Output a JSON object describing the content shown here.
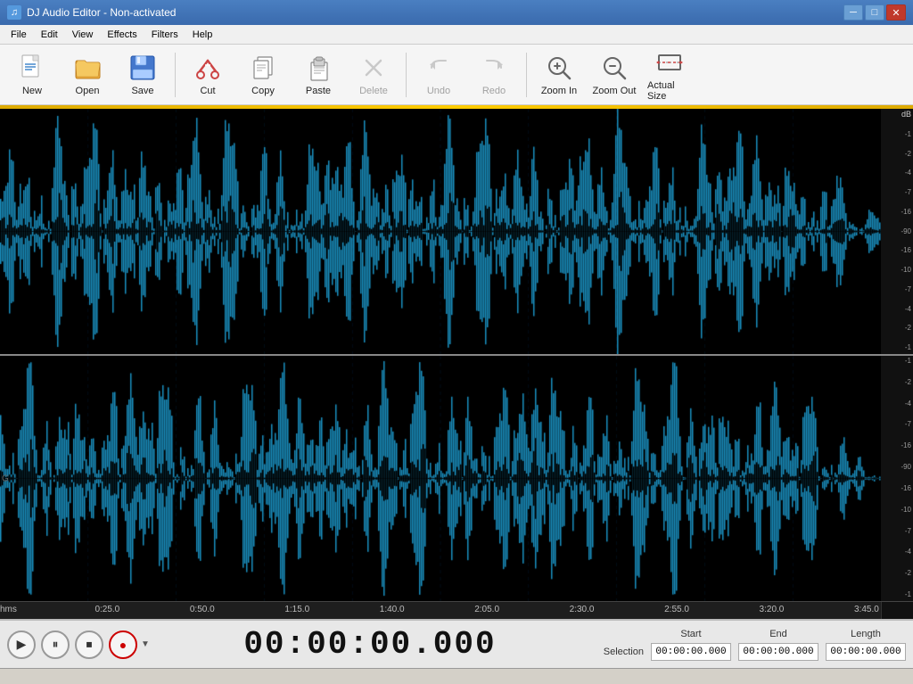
{
  "window": {
    "title": "DJ Audio Editor - Non-activated",
    "icon": "♫"
  },
  "title_buttons": {
    "minimize": "─",
    "maximize": "□",
    "close": "✕"
  },
  "menu": {
    "items": [
      "File",
      "Edit",
      "View",
      "Effects",
      "Filters",
      "Help"
    ]
  },
  "toolbar": {
    "buttons": [
      {
        "id": "new",
        "label": "New",
        "enabled": true
      },
      {
        "id": "open",
        "label": "Open",
        "enabled": true
      },
      {
        "id": "save",
        "label": "Save",
        "enabled": true
      },
      {
        "id": "cut",
        "label": "Cut",
        "enabled": true
      },
      {
        "id": "copy",
        "label": "Copy",
        "enabled": true
      },
      {
        "id": "paste",
        "label": "Paste",
        "enabled": true
      },
      {
        "id": "delete",
        "label": "Delete",
        "enabled": false
      },
      {
        "id": "undo",
        "label": "Undo",
        "enabled": false
      },
      {
        "id": "redo",
        "label": "Redo",
        "enabled": false
      },
      {
        "id": "zoom-in",
        "label": "Zoom In",
        "enabled": true
      },
      {
        "id": "zoom-out",
        "label": "Zoom Out",
        "enabled": true
      },
      {
        "id": "actual-size",
        "label": "Actual Size",
        "enabled": true
      }
    ]
  },
  "db_scale_top": [
    "dB",
    "-1",
    "-2",
    "-4",
    "-7",
    "-16",
    "-90",
    "-16",
    "-10",
    "-7",
    "-4",
    "-2",
    "-1"
  ],
  "db_scale_bottom": [
    "-1",
    "-2",
    "-4",
    "-7",
    "-16",
    "-90",
    "-16",
    "-10",
    "-7",
    "-4",
    "-2",
    "-1"
  ],
  "timeline": {
    "markers": [
      "hms",
      "0:25.0",
      "0:50.0",
      "1:15.0",
      "1:40.0",
      "2:05.0",
      "2:30.0",
      "2:55.0",
      "3:20.0",
      "3:45.0"
    ]
  },
  "transport": {
    "play_label": "▶",
    "pause_label": "⏸",
    "stop_label": "⏹",
    "record_label": "●"
  },
  "time_display": "00:00:00.000",
  "selection": {
    "label": "Selection",
    "start_header": "Start",
    "end_header": "End",
    "length_header": "Length",
    "start_value": "00:00:00.000",
    "end_value": "00:00:00.000",
    "length_value": "00:00:00.000"
  }
}
